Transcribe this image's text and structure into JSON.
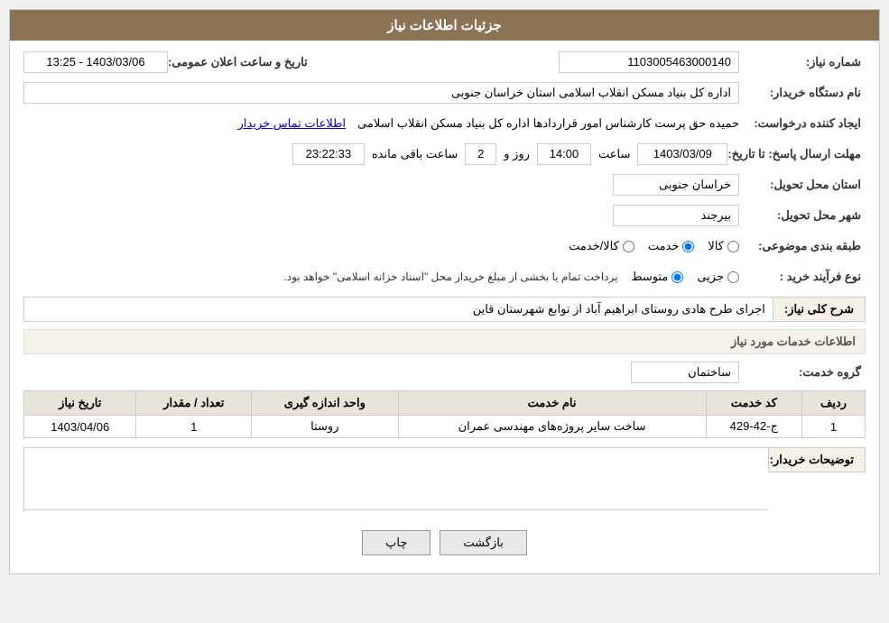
{
  "header": {
    "title": "جزئیات اطلاعات نیاز"
  },
  "fields": {
    "shomareNiaz_label": "شماره نیاز:",
    "shomareNiaz_value": "1103005463000140",
    "namDastgah_label": "نام دستگاه خریدار:",
    "namDastgah_value": "اداره کل بنیاد مسکن انقلاب اسلامی استان خراسان جنوبی",
    "ijadKonande_label": "ایجاد کننده درخواست:",
    "ijadKonande_value": "حمیده حق پرست کارشناس امور قراردادها اداره کل بنیاد مسکن انقلاب اسلامی",
    "ijtilaat_link": "اطلاعات تماس خریدار",
    "mohlatErsal_label": "مهلت ارسال پاسخ: تا تاریخ:",
    "tarikhPasokh": "1403/03/09",
    "saat_label": "ساعت",
    "saat_value": "14:00",
    "rooz_label": "روز و",
    "rooz_value": "2",
    "baghimande_label": "ساعت باقی مانده",
    "baghimande_value": "23:22:33",
    "tarikhElan_label": "تاریخ و ساعت اعلان عمومی:",
    "tarikhElan_value": "1403/03/06 - 13:25",
    "ostanTahvil_label": "استان محل تحویل:",
    "ostanTahvil_value": "خراسان جنوبی",
    "shahrTahvil_label": "شهر محل تحویل:",
    "shahrTahvil_value": "بیرجند",
    "tabaqeBandi_label": "طبقه بندی موضوعی:",
    "tabaqeBandi_options": [
      {
        "label": "کالا",
        "value": "kala"
      },
      {
        "label": "خدمت",
        "value": "khedmat"
      },
      {
        "label": "کالا/خدمت",
        "value": "kala_khedmat"
      }
    ],
    "tabaqeBandi_selected": "khedmat",
    "noeFarayand_label": "نوع فرآیند خرید :",
    "noeFarayand_options": [
      {
        "label": "جزیی",
        "value": "jozi"
      },
      {
        "label": "متوسط",
        "value": "motevasset"
      }
    ],
    "noeFarayand_selected": "motevasset",
    "noeFarayand_note": "پرداخت تمام یا بخشی از مبلغ خریداز محل \"اسناد خزانه اسلامی\" خواهد بود.",
    "sharhKoli_label": "شرح کلی نیاز:",
    "sharhKoli_value": "اجرای طرح هادی روستای ابراهیم آباد از توابع شهرستان قاین",
    "khadamatSection": "اطلاعات خدمات مورد نیاز",
    "geroheKhadamat_label": "گروه خدمت:",
    "geroheKhadamat_value": "ساختمان",
    "table": {
      "headers": [
        "ردیف",
        "کد خدمت",
        "نام خدمت",
        "واحد اندازه گیری",
        "تعداد / مقدار",
        "تاریخ نیاز"
      ],
      "rows": [
        {
          "radif": "1",
          "kodKhadamat": "ج-42-429",
          "namKhadamat": "ساخت سایر پروژه‌های مهندسی عمران",
          "vahed": "روستا",
          "tedad": "1",
          "tarikh": "1403/04/06"
        }
      ]
    },
    "toseifat_label": "توضیحات خریدار:",
    "toseifat_value": "",
    "btn_print": "چاپ",
    "btn_back": "بازگشت"
  }
}
